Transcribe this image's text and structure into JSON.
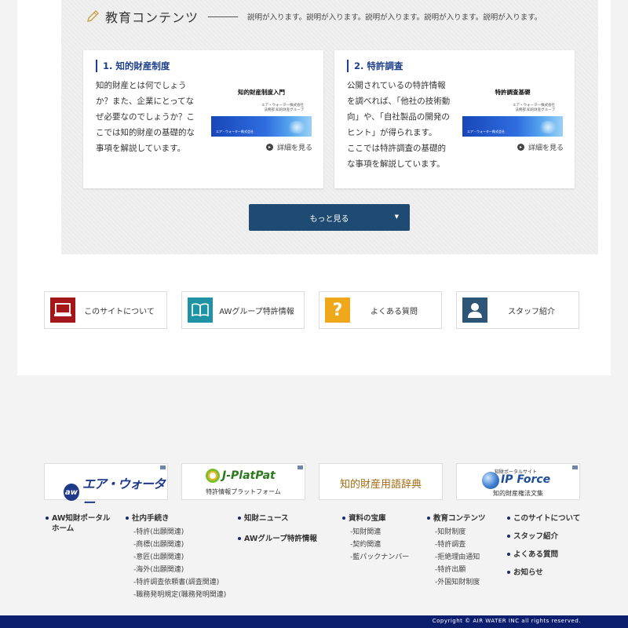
{
  "edu": {
    "title": "教育コンテンツ",
    "description": "説明が入ります。説明が入ります。説明が入ります。説明が入ります。説明が入ります。"
  },
  "cards": [
    {
      "title": "1. 知的財産制度",
      "text": "知的財産とは何でしょうか？また、企業にとってなぜ必要なのでしょうか？ここでは知的財産の基礎的な事項を解説しています。",
      "thumb_title": "知的財産制度入門",
      "thumb_sub": "エア・ウォーター株式会社\n法務部 知的財産グループ",
      "thumb_logo": "エア・ウォーター株式会社",
      "more": "詳細を見る"
    },
    {
      "title": "2. 特許調査",
      "text": "公開されているの特許情報を調べれば、「他社の技術動向」や、「自社製品の開発のヒント」が得られます。\nここでは特許調査の基礎的な事項を解説しています。",
      "thumb_title": "特許調査基礎",
      "thumb_sub": "エア・ウォーター株式会社\n法務部 知的財産グループ",
      "thumb_logo": "エア・ウォーター株式会社",
      "more": "詳細を見る"
    }
  ],
  "more_button": "もっと見る",
  "links": [
    {
      "label": "このサイトについて",
      "icon": "computer-icon",
      "color": "#a4161a"
    },
    {
      "label": "AWグループ特許情報",
      "icon": "book-icon",
      "color": "#1f93a4"
    },
    {
      "label": "よくある質問",
      "icon": "question-icon",
      "color": "#f0a81b"
    },
    {
      "label": "スタッフ紹介",
      "icon": "person-icon",
      "color": "#2c5577"
    }
  ],
  "banners": {
    "aw_logo": "エア・ウォーター",
    "jplat_name": "J-PlatPat",
    "jplat_sub": "特許情報プラットフォーム",
    "dict": "知的財産用語辞典",
    "ipf_top": "知財ポータルサイト",
    "ipf_name": "IP Force",
    "ipf_sub": "知的財産権法文集"
  },
  "footer": {
    "col1": {
      "main": "AW知財ポータルホーム"
    },
    "col2": {
      "main": "社内手続き",
      "subs": [
        "-特許(出願関連)",
        "-商標(出願関連)",
        "-意匠(出願関連)",
        "-海外(出願関連)",
        "-特許調査依頼書(調査関連)",
        "-職務発明規定(職務発明関連)"
      ]
    },
    "col3": {
      "main1": "知財ニュース",
      "main2": "AWグループ特許情報"
    },
    "col4": {
      "main": "資料の宝庫",
      "subs": [
        "-知財関連",
        "-契約関連",
        "-藍パックナンバー"
      ]
    },
    "col5": {
      "main": "教育コンテンツ",
      "subs": [
        "-知財制度",
        "-特許調査",
        "-拒絶理由通知",
        "-特許出願",
        "-外国知財制度"
      ]
    },
    "col6": {
      "mains": [
        "このサイトについて",
        "スタッフ紹介",
        "よくある質問",
        "お知らせ"
      ]
    }
  },
  "copyright": "Copyright © AIR WATER INC all rights reserved."
}
